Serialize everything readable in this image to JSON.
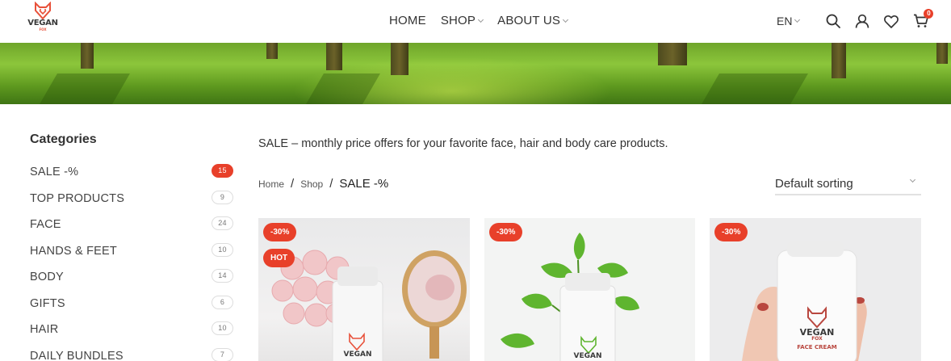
{
  "brand": {
    "name": "VEGAN",
    "sub": "FOX",
    "accent": "#e8402a"
  },
  "nav": {
    "items": [
      {
        "label": "HOME",
        "has_dropdown": false
      },
      {
        "label": "SHOP",
        "has_dropdown": true
      },
      {
        "label": "ABOUT US",
        "has_dropdown": true
      }
    ]
  },
  "tools": {
    "language": "EN",
    "search_icon": "search-icon",
    "account_icon": "user-icon",
    "wishlist_icon": "heart-icon",
    "cart_icon": "cart-icon",
    "cart_count": "0"
  },
  "sidebar": {
    "title": "Categories",
    "items": [
      {
        "label": "SALE -%",
        "count": "15",
        "active": true
      },
      {
        "label": "TOP PRODUCTS",
        "count": "9"
      },
      {
        "label": "FACE",
        "count": "24"
      },
      {
        "label": "HANDS & FEET",
        "count": "10"
      },
      {
        "label": "BODY",
        "count": "14"
      },
      {
        "label": "GIFTS",
        "count": "6"
      },
      {
        "label": "HAIR",
        "count": "10"
      },
      {
        "label": "DAILY BUNDLES",
        "count": "7"
      }
    ]
  },
  "main": {
    "intro": "SALE – monthly price offers for your favorite face, hair and body care products.",
    "breadcrumb": {
      "home": "Home",
      "shop": "Shop",
      "current": "SALE -%"
    },
    "sorting": "Default sorting",
    "products": [
      {
        "badges": [
          "-30%",
          "HOT"
        ],
        "bottle_text": "VEGAN"
      },
      {
        "badges": [
          "-30%"
        ],
        "bottle_text": "VEGAN"
      },
      {
        "badges": [
          "-30%"
        ],
        "bottle_text": "VEGAN",
        "bottle_sub": "FOX",
        "bottle_line": "FACE CREAM"
      }
    ]
  }
}
